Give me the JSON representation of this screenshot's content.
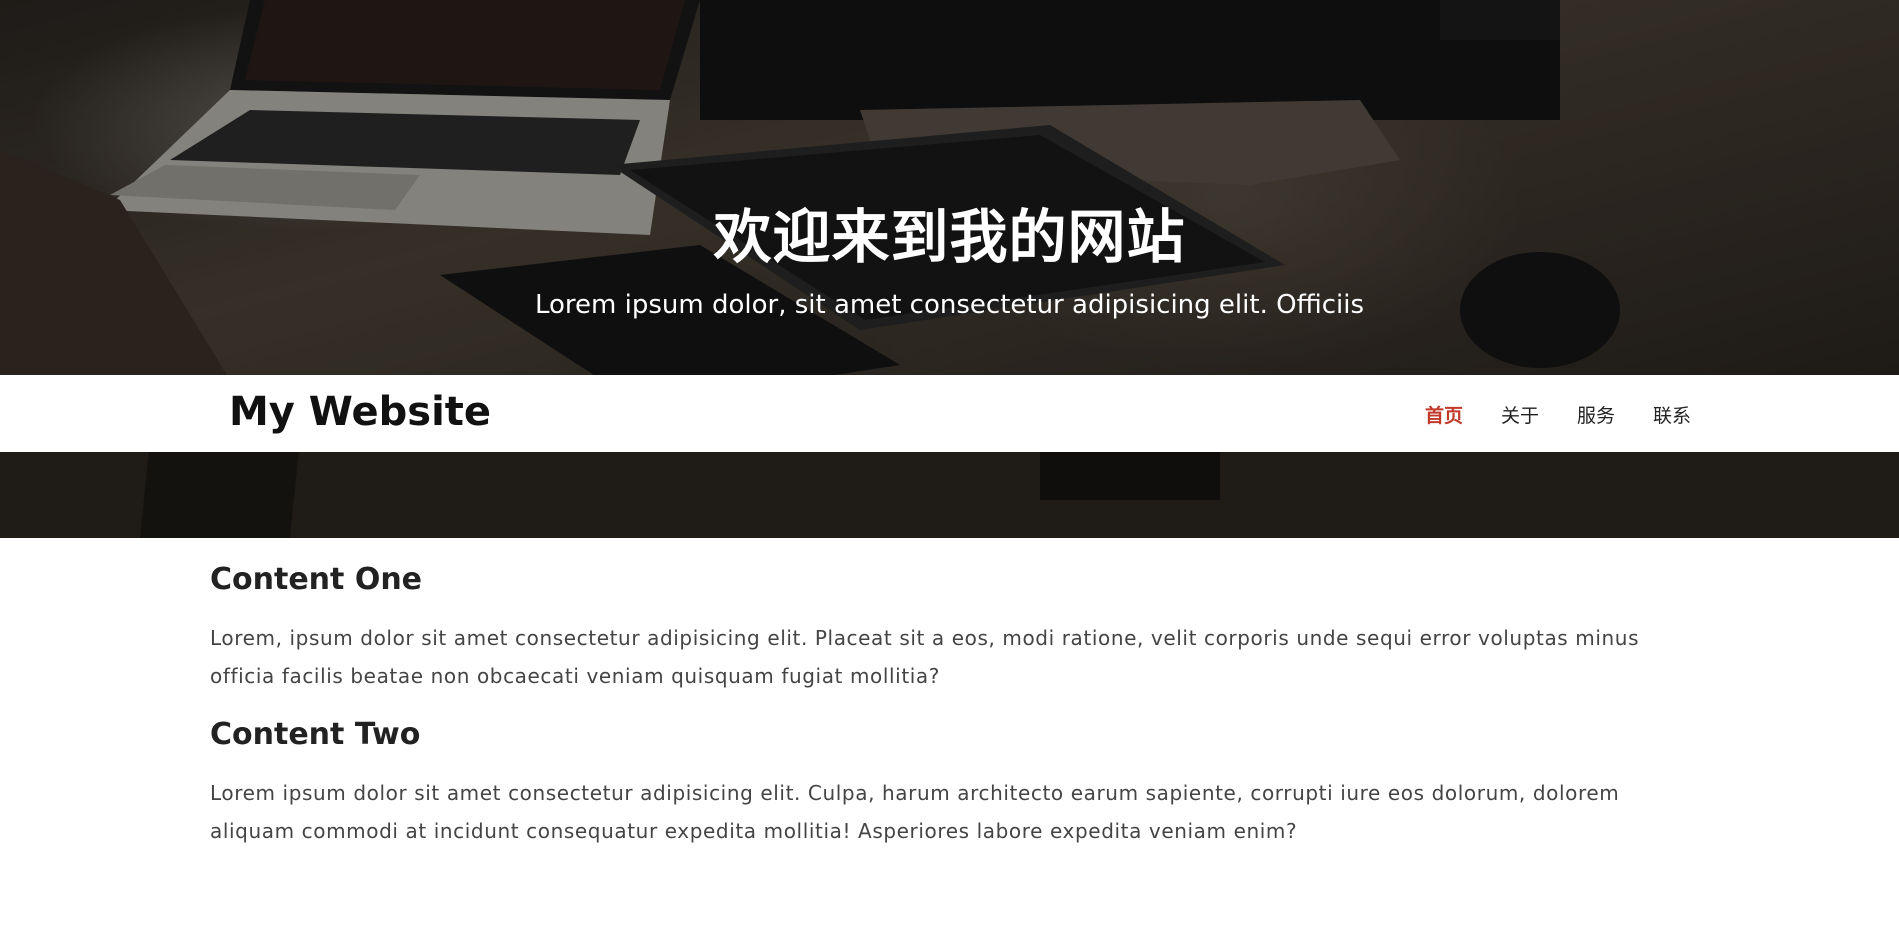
{
  "hero": {
    "title": "欢迎来到我的网站",
    "subtitle": "Lorem ipsum dolor, sit amet consectetur adipisicing elit. Officiis"
  },
  "navbar": {
    "logo": "My Website",
    "links": [
      {
        "label": "首页",
        "active": true
      },
      {
        "label": "关于",
        "active": false
      },
      {
        "label": "服务",
        "active": false
      },
      {
        "label": "联系",
        "active": false
      }
    ],
    "active_color": "#c0392b"
  },
  "content": {
    "sections": [
      {
        "heading": "Content One",
        "body": "Lorem, ipsum dolor sit amet consectetur adipisicing elit. Placeat sit a eos, modi ratione, velit corporis unde sequi error voluptas minus officia facilis beatae non obcaecati veniam quisquam fugiat mollitia?"
      },
      {
        "heading": "Content Two",
        "body": "Lorem ipsum dolor sit amet consectetur adipisicing elit. Culpa, harum architecto earum sapiente, corrupti iure eos dolorum, dolorem aliquam commodi at incidunt consequatur expedita mollitia! Asperiores labore expedita veniam enim?"
      }
    ]
  }
}
